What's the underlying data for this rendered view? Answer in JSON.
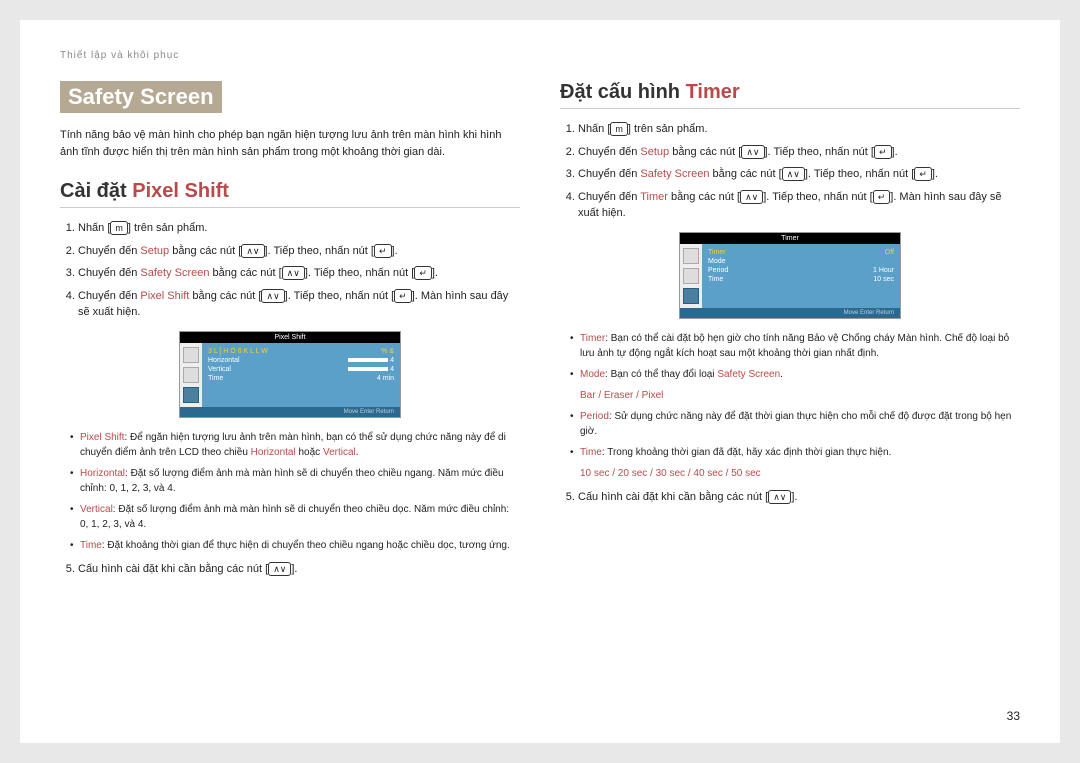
{
  "header": "Thiết lập và khôi phục",
  "page_number": "33",
  "left": {
    "banner": "Safety Screen",
    "intro": "Tính năng bảo vệ màn hình cho phép bạn ngăn hiện tượng lưu ảnh trên màn hình khi hình ảnh tĩnh được hiển thị trên màn hình sản phẩm trong một khoảng thời gian dài.",
    "h2_a": "Cài đặt ",
    "h2_b": "Pixel Shift",
    "step1_a": "Nhấn [",
    "step1_b": "] trên sản phẩm.",
    "step2_a": "Chuyển đến ",
    "step2_setup": "Setup",
    "step2_b": " bằng các nút [",
    "step2_c": "]. Tiếp theo, nhấn nút [",
    "step2_d": "].",
    "step3_a": "Chuyển đến ",
    "step3_safety": "Safety Screen",
    "step3_b": " bằng các nút [",
    "step3_c": "]. Tiếp theo, nhấn nút [",
    "step3_d": "].",
    "step4_a": "Chuyển đến ",
    "step4_pixel": "Pixel Shift",
    "step4_b": " bằng các nút [",
    "step4_c": "]. Tiếp theo, nhấn nút [",
    "step4_d": "]. Màn hình sau đây sẽ xuất hiện.",
    "osd_title": "Pixel Shift",
    "osd_header_left": "3 L [ H O   6 K L L W",
    "osd_header_right": "% &",
    "osd_rows": [
      {
        "label": "Horizontal",
        "value": "4"
      },
      {
        "label": "Vertical",
        "value": "4"
      },
      {
        "label": "Time",
        "value": "4 min"
      }
    ],
    "osd_footer": "Move    Enter    Return",
    "b1_lbl": "Pixel Shift",
    "b1_txt": ": Để ngăn hiện tượng lưu ảnh trên màn hình, bạn có thể sử dụng chức năng này để di chuyển điểm ảnh trên LCD theo chiều ",
    "b1_h": "Horizontal",
    "b1_or": " hoặc ",
    "b1_v": "Vertical",
    "b1_end": ".",
    "b2_lbl": "Horizontal",
    "b2_txt": ": Đặt số lượng điểm ảnh mà màn hình sẽ di chuyển theo chiều ngang. Năm mức điều chỉnh: 0, 1, 2, 3, và 4.",
    "b3_lbl": "Vertical",
    "b3_txt": ": Đặt số lượng điểm ảnh mà màn hình sẽ di chuyển theo chiều dọc. Năm mức điều chỉnh: 0, 1, 2, 3, và 4.",
    "b4_lbl": "Time",
    "b4_txt": ": Đặt khoảng thời gian để thực hiện di chuyển theo chiều ngang hoặc chiều dọc, tương ứng.",
    "step5_a": "Cấu hình cài đặt khi cần bằng các nút [",
    "step5_b": "]."
  },
  "right": {
    "h2_a": "Đặt cấu hình ",
    "h2_b": "Timer",
    "step1_a": "Nhấn [",
    "step1_b": "] trên sản phẩm.",
    "step2_a": "Chuyển đến ",
    "step2_setup": "Setup",
    "step2_b": " bằng các nút [",
    "step2_c": "]. Tiếp theo, nhấn nút [",
    "step2_d": "].",
    "step3_a": "Chuyển đến ",
    "step3_safety": "Safety Screen",
    "step3_b": " bằng các nút [",
    "step3_c": "]. Tiếp theo, nhấn nút [",
    "step3_d": "].",
    "step4_a": "Chuyển đến ",
    "step4_timer": "Timer",
    "step4_b": " bằng các nút [",
    "step4_c": "]. Tiếp theo, nhấn nút [",
    "step4_d": "]. Màn hình sau đây sẽ xuất hiện.",
    "osd_title": "Timer",
    "osd_rows": [
      {
        "label": "Timer",
        "value": "Off",
        "hl": true
      },
      {
        "label": "Mode",
        "value": ""
      },
      {
        "label": "Period",
        "value": "1  Hour"
      },
      {
        "label": "Time",
        "value": "10 sec"
      }
    ],
    "osd_footer": "Move    Enter    Return",
    "b1_lbl": "Timer",
    "b1_txt": ": Bạn có thể cài đặt bộ hẹn giờ cho tính năng Bảo vệ Chống cháy Màn hình. Chế độ loại bỏ lưu ảnh tự động ngắt kích hoạt sau một khoảng thời gian nhất định.",
    "b2_lbl": "Mode",
    "b2_txt": ": Bạn có thể thay đổi loại ",
    "b2_safety": "Safety Screen",
    "b2_end": ".",
    "b2_sub": "Bar / Eraser / Pixel",
    "b3_lbl": "Period",
    "b3_txt": ": Sử dụng chức năng này để đặt thời gian thực hiện cho mỗi chế độ được đặt trong bộ hẹn giờ.",
    "b4_lbl": "Time",
    "b4_txt": ": Trong khoảng thời gian đã đặt, hãy xác định thời gian thực hiện.",
    "b4_sub": "10 sec / 20 sec / 30 sec / 40 sec / 50 sec",
    "step5_a": "Cấu hình cài đặt khi cần bằng các nút [",
    "step5_b": "]."
  }
}
